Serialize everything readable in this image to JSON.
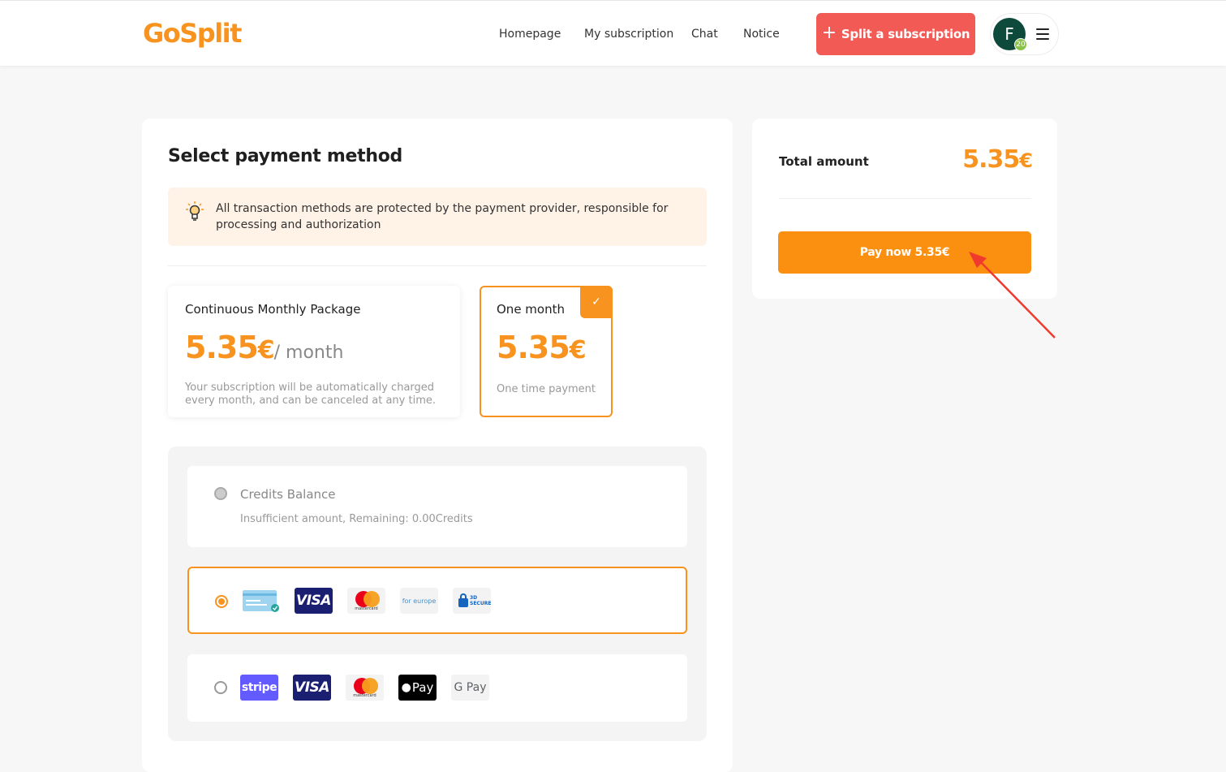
{
  "header": {
    "logo": "GoSplit",
    "nav": [
      "Homepage",
      "My subscription",
      "Chat",
      "Notice"
    ],
    "split_button": "Split a subscription",
    "avatar_letter": "F",
    "avatar_badge": "20"
  },
  "payment": {
    "title": "Select payment method",
    "notice": "All transaction methods are protected by the payment provider, responsible for processing and authorization",
    "packages": [
      {
        "name": "Continuous Monthly Package",
        "price": "5.35",
        "currency": "€",
        "period": "/ month",
        "description": "Your subscription will be automatically charged every month, and can be canceled at any time.",
        "selected": false
      },
      {
        "name": "One month",
        "price": "5.35",
        "currency": "€",
        "description": "One time payment",
        "selected": true
      }
    ],
    "methods": {
      "credits": {
        "title": "Credits Balance",
        "subtitle": "Insufficient amount, Remaining: 0.00Credits"
      },
      "card_logos": [
        "credit-card",
        "VISA",
        "mastercard",
        "for europe",
        "3D SECURE"
      ],
      "wallet_logos": [
        "stripe",
        "VISA",
        "mastercard",
        "Pay",
        "G Pay"
      ],
      "selected": "card"
    }
  },
  "summary": {
    "total_label": "Total amount",
    "total_value": "5.35",
    "currency": "€",
    "pay_button": "Pay now 5.35€"
  },
  "colors": {
    "accent": "#f7931e",
    "split_button": "#f25a55",
    "pay_button": "#fb8f0f",
    "annotation_arrow": "#f03a2e"
  }
}
